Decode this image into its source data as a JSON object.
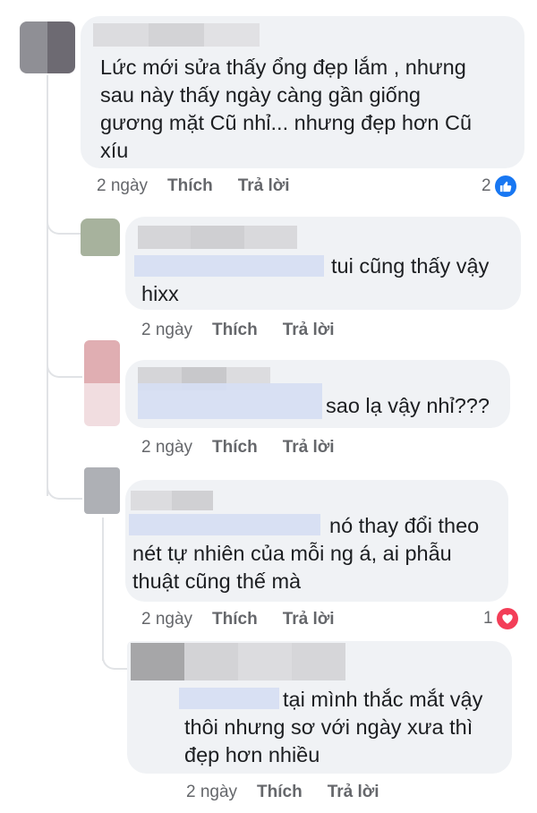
{
  "comments": [
    {
      "text": "Lức mới sửa thấy ổng đẹp lắm , nhưng\nsau này thấy ngày càng gần giống\ngương mặt Cũ nhỉ... nhưng đẹp hơn Cũ\nxíu",
      "time": "2 ngày",
      "like": "Thích",
      "reply": "Trả lời",
      "reaction_count": "2",
      "reaction_icon": "like-icon"
    },
    {
      "text": "tui cũng thấy vậy\nhixx",
      "time": "2 ngày",
      "like": "Thích",
      "reply": "Trả lời"
    },
    {
      "text": "sao lạ vậy nhỉ???",
      "time": "2 ngày",
      "like": "Thích",
      "reply": "Trả lời"
    },
    {
      "text": "nó thay đổi theo\nnét tự nhiên của mỗi ng á, ai phẫu\nthuật cũng thế mà",
      "time": "2 ngày",
      "like": "Thích",
      "reply": "Trả lời",
      "reaction_count": "1",
      "reaction_icon": "love-icon"
    },
    {
      "text": "tại mình thắc mắt vậy\nthôi nhưng sơ với ngày xưa thì\nđẹp hơn nhiều",
      "time": "2 ngày",
      "like": "Thích",
      "reply": "Trả lời"
    }
  ],
  "colors": {
    "bubble": "#f0f2f5",
    "meta_text": "#65676b",
    "like_blue": "#1877f2",
    "love_red": "#f33e58"
  }
}
